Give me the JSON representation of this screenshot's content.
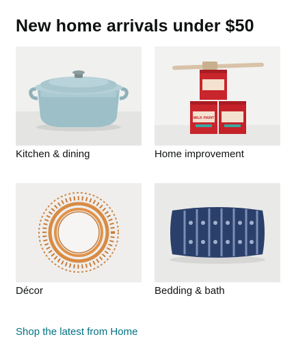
{
  "card": {
    "title": "New home arrivals under $50",
    "tiles": [
      {
        "label": "Kitchen & dining",
        "image": "dutch-oven-pot"
      },
      {
        "label": "Home improvement",
        "image": "paint-cans"
      },
      {
        "label": "Décor",
        "image": "rattan-sunburst-mirror"
      },
      {
        "label": "Bedding & bath",
        "image": "indigo-lumbar-pillow"
      }
    ],
    "paint_can_label": "MILK PAINT",
    "footer_link": "Shop the latest from Home"
  },
  "colors": {
    "link": "#007185",
    "text": "#0f1111"
  }
}
